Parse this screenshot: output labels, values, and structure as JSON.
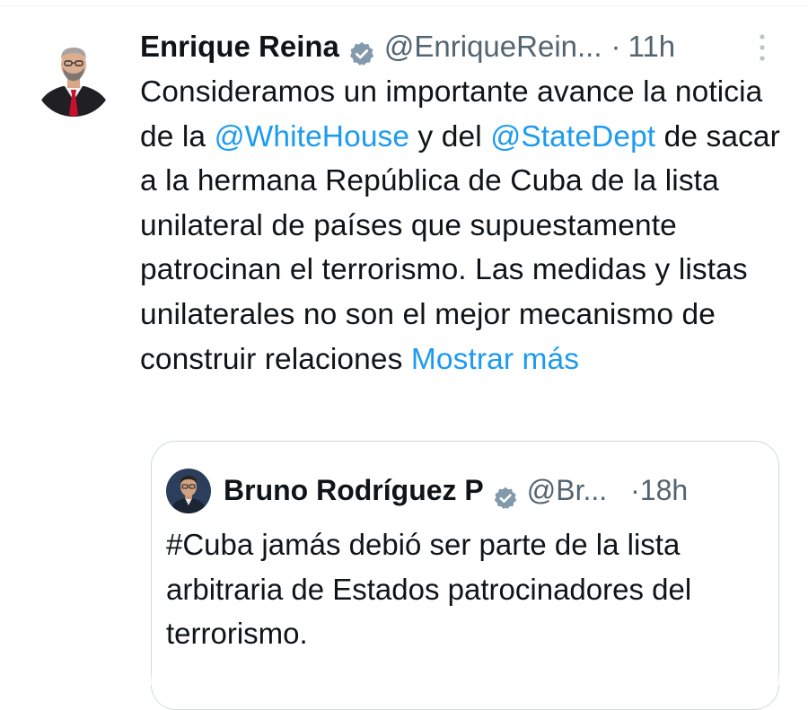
{
  "tweet": {
    "author_name": "Enrique Reina",
    "handle": "@EnriqueRein...",
    "separator": "·",
    "time": "11h",
    "avatar_icon": "person-avatar",
    "verified_icon": "verified-badge-icon",
    "more_icon": "more-options-icon",
    "body": {
      "part1": "Consideramos un importante avance la noticia de la ",
      "mention1": "@WhiteHouse",
      "part2": " y del ",
      "mention2": "@StateDept",
      "part3": " de sacar a la hermana República de Cuba de la lista unilateral de países que supuestamente patrocinan el terrorismo. Las medidas y listas unilaterales no son el mejor mecanismo de construir relaciones ",
      "show_more": "Mostrar más"
    }
  },
  "quoted_tweet": {
    "author_name": "Bruno Rodríguez P",
    "handle": "@Br...",
    "separator": "·",
    "time": "18h",
    "avatar_icon": "person-avatar",
    "verified_icon": "verified-badge-icon",
    "body": "#Cuba jamás debió ser parte de la lista arbitraria de Estados patrocinadores del terrorismo."
  },
  "colors": {
    "text": "#0f1419",
    "secondary": "#536471",
    "link": "#1d9bf0",
    "border": "#cfd9de",
    "verified": "#829aab"
  }
}
